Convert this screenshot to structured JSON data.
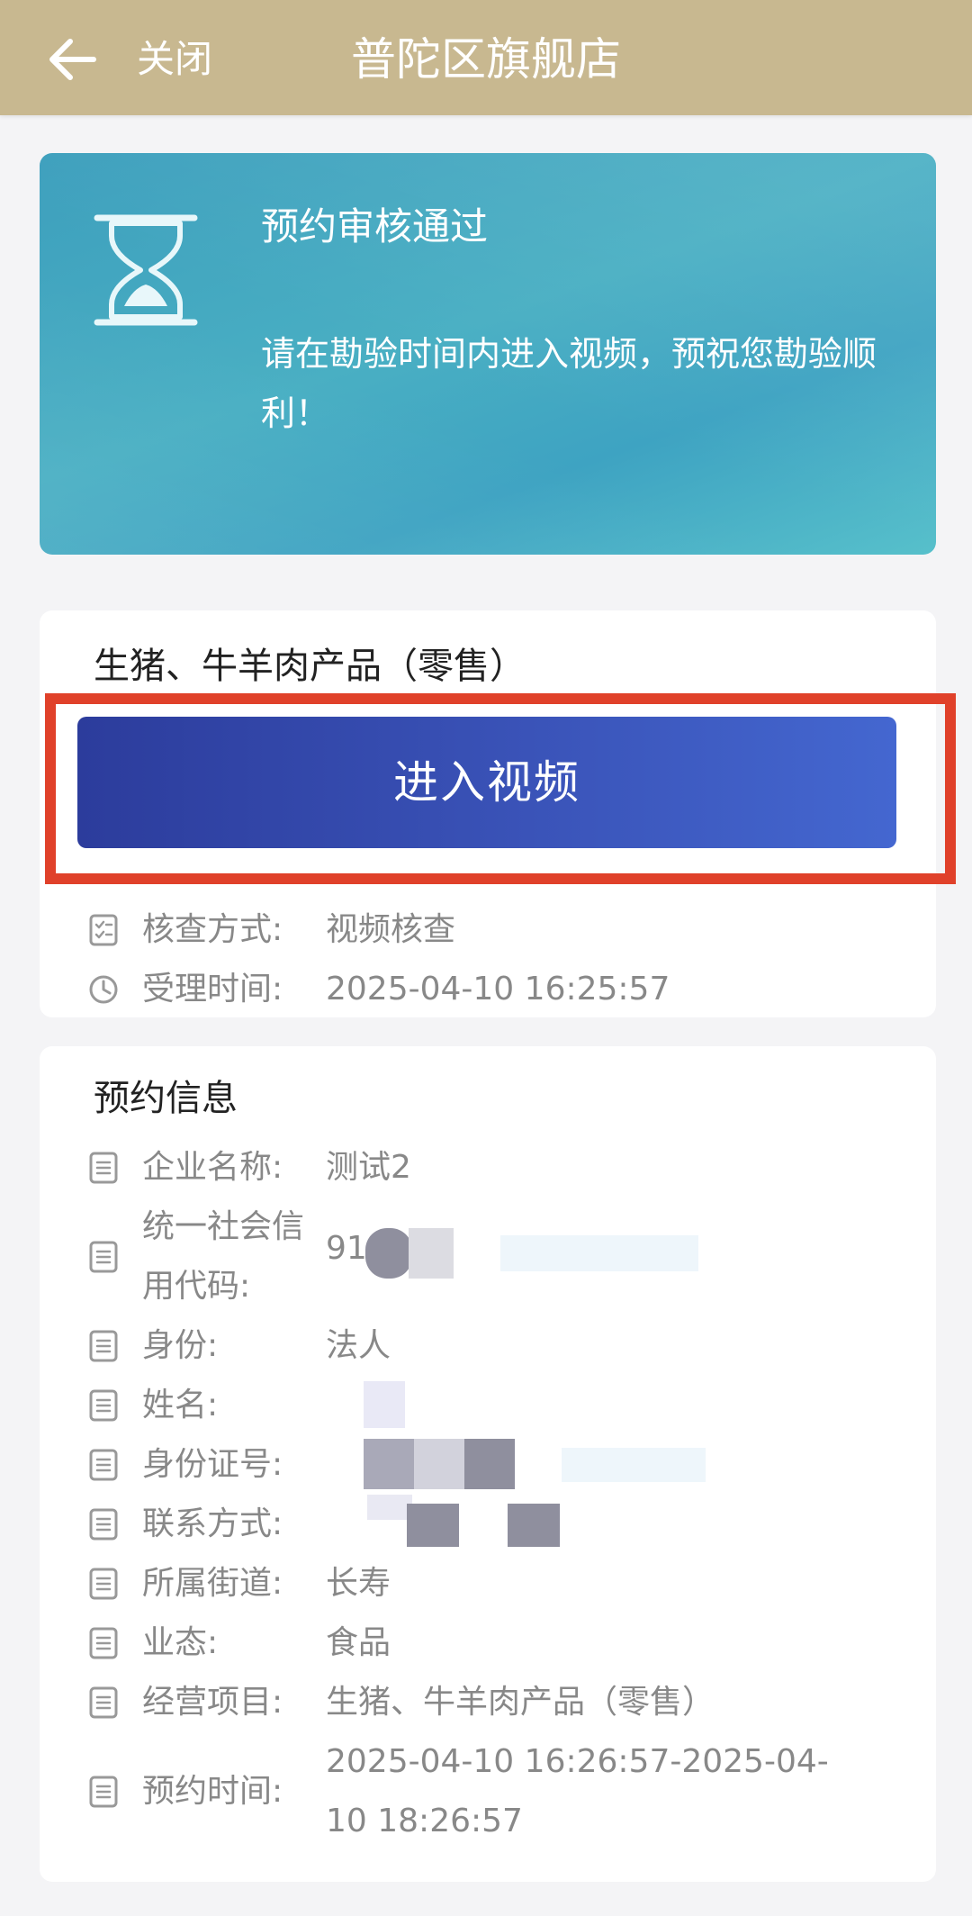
{
  "header": {
    "back_icon": "arrow-left-icon",
    "close_label": "关闭",
    "title": "普陀区旗舰店",
    "background_color": "#c8b890"
  },
  "status": {
    "icon": "hourglass-icon",
    "title": "预约审核通过",
    "description": "请在勘验时间内进入视频，预祝您勘验顺利！",
    "background_color": "#45a8c2"
  },
  "inspection": {
    "item_title": "生猪、牛羊肉产品（零售）",
    "enter_button_label": "进入视频",
    "highlight_color": "#e0412a",
    "button_color": "#3a4fb4",
    "rows": [
      {
        "icon": "checklist-icon",
        "label": "核查方式:",
        "value": "视频核查"
      },
      {
        "icon": "clock-icon",
        "label": "受理时间:",
        "value": "2025-04-10 16:25:57"
      }
    ]
  },
  "booking": {
    "title": "预约信息",
    "rows": [
      {
        "icon": "document-icon",
        "label": "企业名称:",
        "value": "测试2"
      },
      {
        "icon": "document-icon",
        "label": "统一社会信用代码:",
        "value": "91"
      },
      {
        "icon": "document-icon",
        "label": "身份:",
        "value": "法人"
      },
      {
        "icon": "document-icon",
        "label": "姓名:",
        "value": ""
      },
      {
        "icon": "document-icon",
        "label": "身份证号:",
        "value": ""
      },
      {
        "icon": "document-icon",
        "label": "联系方式:",
        "value": ""
      },
      {
        "icon": "document-icon",
        "label": "所属街道:",
        "value": "长寿"
      },
      {
        "icon": "document-icon",
        "label": "业态:",
        "value": "食品"
      },
      {
        "icon": "document-icon",
        "label": "经营项目:",
        "value": "生猪、牛羊肉产品（零售）"
      },
      {
        "icon": "document-icon",
        "label": "预约时间:",
        "value": "2025-04-10 16:26:57-2025-04-10 18:26:57"
      }
    ]
  }
}
